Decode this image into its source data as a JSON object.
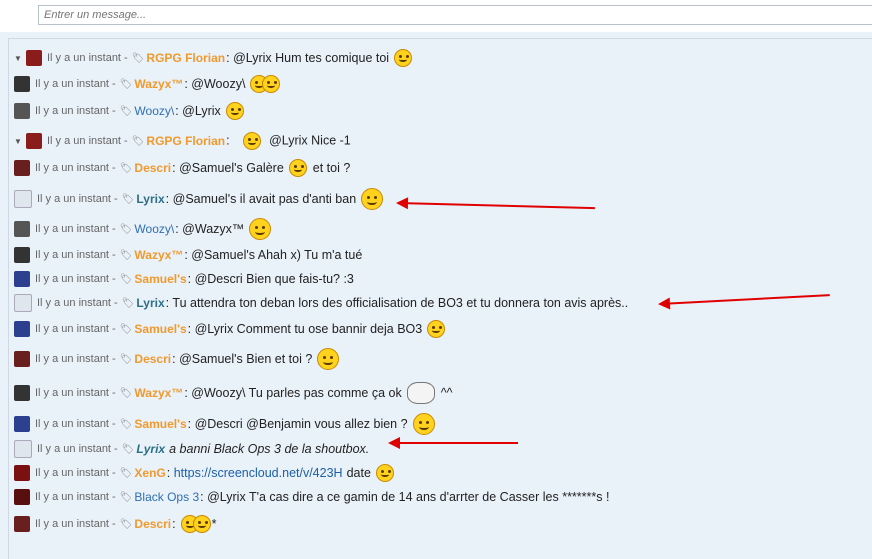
{
  "input": {
    "placeholder": "Entrer un message..."
  },
  "colors": {
    "orange": "#f09a2e",
    "teal": "#2c6f86",
    "blue": "#2f6fb5",
    "arrow": "#e00000"
  },
  "messages": [
    {
      "time": "Il y a un instant -",
      "user": "RGPG Florian",
      "text": "@Lyrix Hum tes comique toi"
    },
    {
      "time": "Il y a un instant -",
      "user": "Wazyx™",
      "text": "@Woozy\\"
    },
    {
      "time": "Il y a un instant -",
      "user": "Woozy\\",
      "text": "@Lyrix"
    },
    {
      "time": "Il y a un instant -",
      "user": "RGPG Florian",
      "text": "@Lyrix Nice -1"
    },
    {
      "time": "Il y a un instant -",
      "user": "Descri",
      "text": "@Samuel's Galère",
      "text2": "et toi ?"
    },
    {
      "time": "Il y a un instant -",
      "user": "Lyrix",
      "text": "@Samuel's il avait pas d'anti ban"
    },
    {
      "time": "Il y a un instant -",
      "user": "Woozy\\",
      "text": "@Wazyx™"
    },
    {
      "time": "Il y a un instant -",
      "user": "Wazyx™",
      "text": "@Samuel's Ahah x) Tu m'a tué"
    },
    {
      "time": "Il y a un instant -",
      "user": "Samuel's",
      "text": "@Descri Bien que fais-tu? :3"
    },
    {
      "time": "Il y a un instant -",
      "user": "Lyrix",
      "text": "Tu attendra ton deban lors des officialisation de BO3 et tu donnera ton avis après.."
    },
    {
      "time": "Il y a un instant -",
      "user": "Samuel's",
      "text": "@Lyrix Comment tu ose bannir deja BO3"
    },
    {
      "time": "Il y a un instant -",
      "user": "Descri",
      "text": "@Samuel's Bien et toi ?"
    },
    {
      "time": "Il y a un instant -",
      "user": "Wazyx™",
      "text": "@Woozy\\ Tu parles pas comme ça ok",
      "text2": "^^"
    },
    {
      "time": "Il y a un instant -",
      "user": "Samuel's",
      "text": "@Descri @Benjamin vous allez bien ?"
    },
    {
      "time": "Il y a un instant -",
      "user": "Lyrix",
      "text": "a banni Black Ops 3 de la shoutbox."
    },
    {
      "time": "Il y a un instant -",
      "user": "XenG",
      "text": "https://screencloud.net/v/423H",
      "text2": "date"
    },
    {
      "time": "Il y a un instant -",
      "user": "Black Ops 3",
      "text": "@Lyrix T'a cas dire a ce gamin de 14 ans d'arrter de Casser les *******s !"
    },
    {
      "time": "Il y a un instant -",
      "user": "Descri",
      "text": "*"
    }
  ]
}
